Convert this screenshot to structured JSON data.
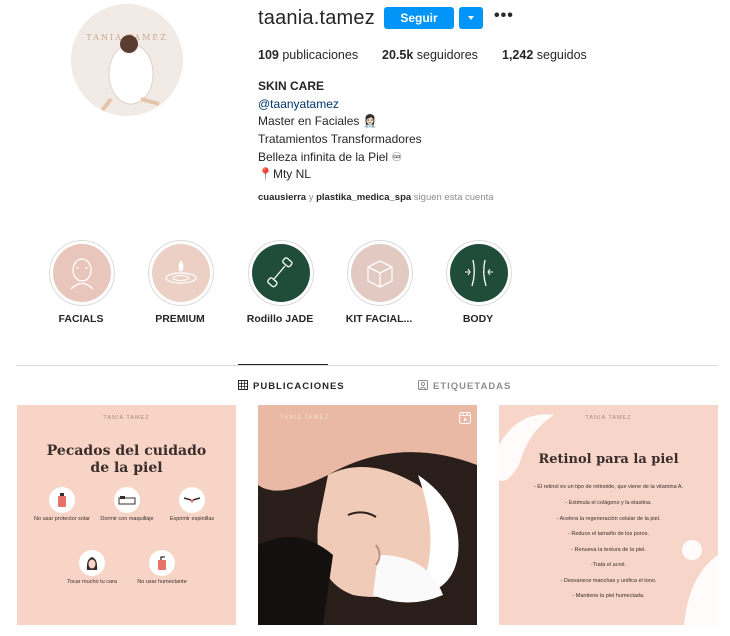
{
  "profile": {
    "username": "taania.tamez",
    "follow_label": "Seguir",
    "avatar_watermark": "TANIA TAMEZ",
    "stats": {
      "posts_value": "109",
      "posts_label": "publicaciones",
      "followers_value": "20.5k",
      "followers_label": "seguidores",
      "following_value": "1,242",
      "following_label": "seguidos"
    },
    "bio": {
      "name": "SKIN CARE",
      "handle": "@taanyatamez",
      "line1": "Master en Faciales 👩🏻‍⚕️",
      "line2": "Tratamientos Transformadores",
      "line3": "Belleza infinita de la Piel ♾",
      "line4": "📍Mty NL"
    },
    "followed_by": {
      "user1": "cuausierra",
      "connector": "y",
      "user2": "plastika_medica_spa",
      "suffix": "siguen esta cuenta"
    }
  },
  "highlights": [
    {
      "label": "FACIALS",
      "icon": "face-icon",
      "color": "#e9c6bb"
    },
    {
      "label": "PREMIUM",
      "icon": "droplet-icon",
      "color": "#ecd0c6"
    },
    {
      "label": "Rodillo JADE",
      "icon": "jade-roller-icon",
      "color": "#1f4d3a"
    },
    {
      "label": "KIT FACIAL...",
      "icon": "box-icon",
      "color": "#e2c9c2"
    },
    {
      "label": "BODY",
      "icon": "body-icon",
      "color": "#1f4d3a"
    }
  ],
  "tabs": {
    "posts": "PUBLICACIONES",
    "tagged": "ETIQUETADAS"
  },
  "posts": {
    "p1": {
      "logo": "TANIA TAMEZ",
      "title_1": "Pecados del cuidado",
      "title_2": "de la piel",
      "tips": [
        "No usar protector solar",
        "Dormir con maquillaje",
        "Exprimir espinillas",
        "Tocar mucho tu cara",
        "No usar humectante"
      ]
    },
    "p2": {
      "watermark": "TANIA TAMEZ"
    },
    "p3": {
      "logo": "TANIA TAMEZ",
      "title": "Retinol para la piel",
      "lines": [
        "- El retinol es un tipo de retinoide, que viene de la vitamina A.",
        "- Estimula el colágeno y la elastina.",
        "- Acelera la regeneración celular de la piel.",
        "- Reduce el tamaño de los poros.",
        "- Renueva la textura de la piel.",
        "-Trata el acné.",
        "- Desvanece manchas y unifica el tono.",
        "- Mantiene la piel humectada."
      ]
    }
  },
  "colors": {
    "accent": "#0095f6",
    "link": "#00376b",
    "text": "#262626",
    "muted": "#8e8e8e",
    "post_pink": "#f7d4c6",
    "jade": "#1f4d3a"
  }
}
